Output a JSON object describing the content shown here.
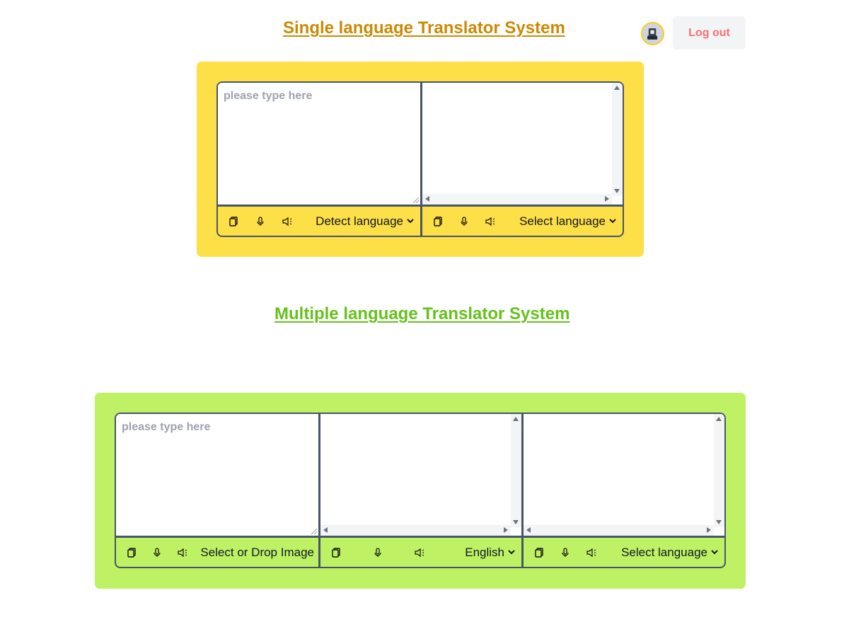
{
  "header": {
    "single_title": "Single language Translator System",
    "logout_label": "Log out"
  },
  "single": {
    "input_placeholder": "please type here",
    "source_language": "Detect language",
    "target_language": "Select language"
  },
  "multi": {
    "title": "Multiple language Translator System",
    "input_placeholder": "please type here",
    "image_label": "Select or Drop Image",
    "target_language_1": "English",
    "target_language_2": "Select language"
  },
  "icons": {
    "copy": "copy-icon",
    "mic": "microphone-icon",
    "speaker": "speaker-icon",
    "avatar": "user-avatar"
  },
  "colors": {
    "single_panel": "#fde047",
    "multi_panel": "#bef264",
    "single_title": "#ca8a04",
    "multi_title": "#65c11b",
    "logout_text": "#f87171",
    "border": "#475569"
  }
}
